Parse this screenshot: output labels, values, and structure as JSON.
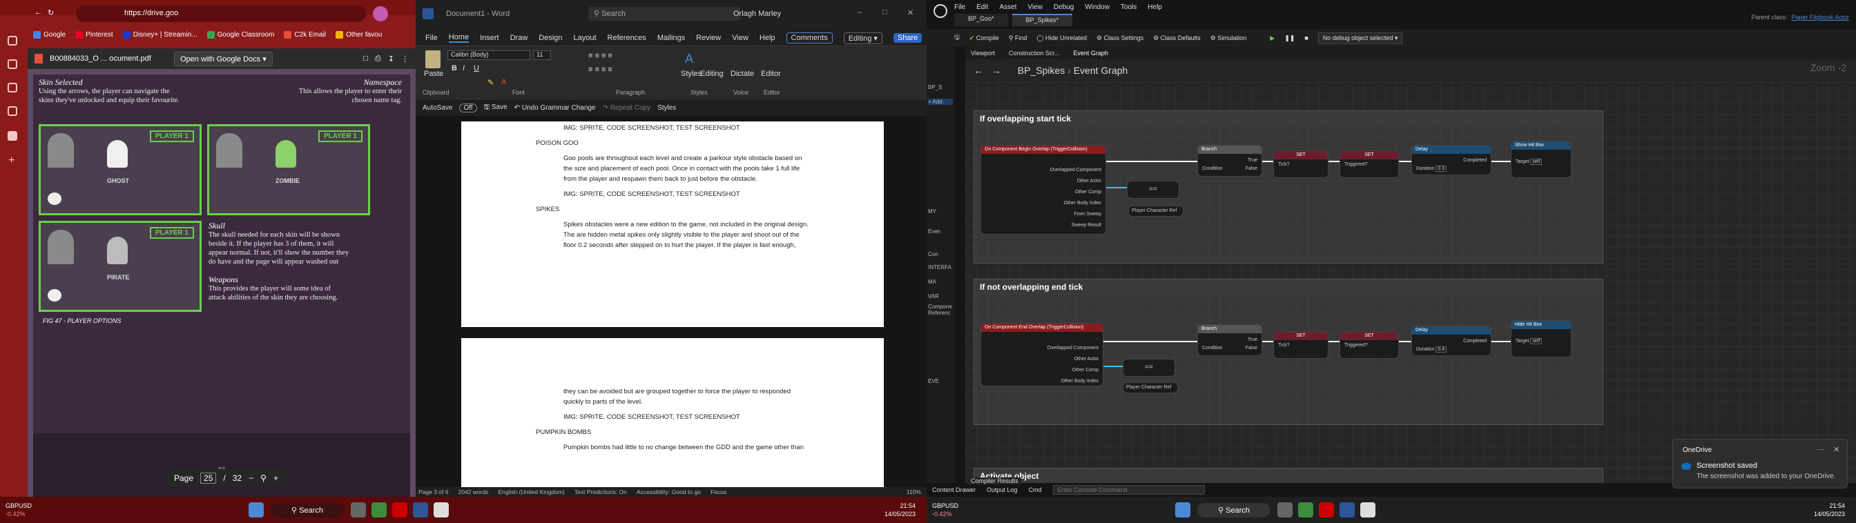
{
  "browser": {
    "url": "https://drive.goo",
    "bookmarks": [
      "Google",
      "Pinterest",
      "Disney+ | Streamin...",
      "Google Classroom",
      "C2k Email",
      "Other favou"
    ],
    "bookmark_colors": [
      "#4285f4",
      "#e60023",
      "#113ccf",
      "#34a853",
      "#e74c3c",
      "#f4b400"
    ],
    "pdf_title": "B00884033_O ... ocument.pdf",
    "open_with": "Open with Google Docs",
    "page": {
      "skin_selected_title": "Skin Selected",
      "skin_selected_text": [
        "Using the arrows, the player can navigate the",
        "skins they've unlocked and equip their favourite."
      ],
      "namespace_title": "Namespace",
      "namespace_text": [
        "This allows the player to enter their",
        "chosen name tag."
      ],
      "skull_title": "Skull",
      "skull_text": [
        "The skull needed for each skin will be shown",
        "beside it. If the player has 3 of them, it will",
        "appear normal. If not, it'll show the number they",
        "do have and the page will appear washed out"
      ],
      "weapons_title": "Weapons",
      "weapons_text": [
        "This provides the player will some idea of",
        "attack abilities of the skin they are choosing."
      ],
      "fig_caption": "FIG 47 - PLAYER OPTIONS",
      "skins": [
        "GHOST",
        "ZOMBIE",
        "PIRATE"
      ],
      "player_label": "PLAYER 1",
      "page_number_mark": "91"
    },
    "page_control": {
      "label": "Page",
      "current": "25",
      "sep": "/",
      "total": "32"
    }
  },
  "word": {
    "title": "Document1 - Word",
    "search": "Search",
    "user": "Orlagh Marley",
    "menu": [
      "File",
      "Home",
      "Insert",
      "Draw",
      "Design",
      "Layout",
      "References",
      "Mailings",
      "Review",
      "View",
      "Help"
    ],
    "comments": "Comments",
    "editing": "Editing",
    "share": "Share",
    "font": "Calibri (Body)",
    "size": "11",
    "groups": [
      "Clipboard",
      "Font",
      "Paragraph",
      "Styles",
      "Voice",
      "Editor"
    ],
    "ribbon_buttons": [
      "Paste",
      "Styles",
      "Editing",
      "Dictate",
      "Editor"
    ],
    "autosave": "AutoSave",
    "autosave_state": "Off",
    "save": "Save",
    "undo": "Undo Grammar Change",
    "repeat": "Repeat Copy",
    "styles_qat": "Styles",
    "page1": [
      {
        "text": "IMG: SPRITE, CODE SCREENSHOT, TEST SCREENSHOT",
        "indent": true
      },
      {
        "text": "POISON GOO",
        "indent": false
      },
      {
        "text": "Goo pools are throughout each level and create a parkour style obstacle based on",
        "indent": true
      },
      {
        "text": "the size and placement of each pool. Once in contact with the pools take 1 full life",
        "indent": true
      },
      {
        "text": "from the player and respawn them back to just before the obstacle.",
        "indent": true
      },
      {
        "text": "IMG: SPRITE, CODE SCREENSHOT, TEST SCREENSHOT",
        "indent": true
      },
      {
        "text": "SPIKES",
        "indent": false
      },
      {
        "text": "Spikes obstacles were a new edition to the game, not included in the original design.",
        "indent": true
      },
      {
        "text": "The are hidden metal spikes only slightly visible to the player and shoot out of the",
        "indent": true
      },
      {
        "text": "floor 0.2 seconds after stepped on to hurt the player. If the player is fast enough,",
        "indent": true
      }
    ],
    "page2": [
      {
        "text": "they can be avoided but are grouped together to force the player to responded",
        "indent": true
      },
      {
        "text": "quickly to parts of the level.",
        "indent": true
      },
      {
        "text": "IMG: SPRITE, CODE SCREENSHOT, TEST SCREENSHOT",
        "indent": true
      },
      {
        "text": "PUMPKIN BOMBS",
        "indent": false
      },
      {
        "text": "Pumpkin bombs had little to no change between the GDD and the game other than",
        "indent": true
      }
    ],
    "status": [
      "Page 3 of 6",
      "2042 words",
      "English (United Kingdom)",
      "Text Predictions: On",
      "Accessibility: Good to go",
      "Focus"
    ],
    "zoom": "110%"
  },
  "ue": {
    "menu": [
      "File",
      "Edit",
      "Asset",
      "View",
      "Debug",
      "Window",
      "Tools",
      "Help"
    ],
    "tabs": [
      "BP_Goo*",
      "BP_Spikes*"
    ],
    "parent_class_label": "Parent class:",
    "parent_class": "Paper Flipbook Actor",
    "toolbar": [
      "Compile",
      "Find",
      "Hide Unrelated",
      "Class Settings",
      "Class Defaults",
      "Simulation"
    ],
    "debug": "No debug object selected",
    "add": "Add",
    "graph_tabs": [
      "Viewport",
      "Construction Scr...",
      "Event Graph"
    ],
    "breadcrumb": [
      "BP_Spikes",
      "Event Graph"
    ],
    "zoom": "Zoom -2",
    "left_items": [
      "BP_S",
      "Add",
      "MY",
      "Even",
      "Con",
      "INTERFA",
      "MA",
      "VAR",
      "Compone",
      "Referenc",
      "EVE"
    ],
    "comment1": "If overlapping start tick",
    "comment2": "If not overlapping end tick",
    "comment3": "Activate object",
    "graph1": {
      "event": "On Component Begin Overlap (TriggerCollision)",
      "pins": [
        "Overlapped Component",
        "Other Actor",
        "Other Comp",
        "Other Body Index",
        "From Sweep",
        "Sweep Result"
      ],
      "equals": "==",
      "player_ref": "Player Character Ref",
      "branch": "Branch",
      "branch_pins": [
        "Condition",
        "True",
        "False"
      ],
      "set1": "SET",
      "set1_var": "Tick?",
      "set2": "SET",
      "set2_var": "Triggered?",
      "delay": "Delay",
      "delay_pins": [
        "Duration",
        "Completed"
      ],
      "delay_val": "0.3",
      "func": "Show Hit Box",
      "func_target_label": "Target",
      "func_target": "self"
    },
    "graph2": {
      "event": "On Component End Overlap (TriggerCollision)",
      "pins": [
        "Overlapped Component",
        "Other Actor",
        "Other Comp",
        "Other Body Index"
      ],
      "equals": "==",
      "player_ref": "Player Character Ref",
      "branch": "Branch",
      "branch_pins": [
        "Condition",
        "True",
        "False"
      ],
      "set1": "SET",
      "set1_var": "Tick?",
      "set2": "SET",
      "set2_var": "Triggered?",
      "delay": "Delay",
      "delay_pins": [
        "Duration",
        "Completed"
      ],
      "delay_val": "0.4",
      "func": "Hide Hit Box",
      "func_target_label": "Target",
      "func_target": "self"
    },
    "bottom": [
      "Content Drawer",
      "Output Log",
      "Cmd",
      "Compiler Results"
    ],
    "console_placeholder": "Enter Console Command",
    "toast_app": "OneDrive",
    "toast_title": "Screenshot saved",
    "toast_body": "The screenshot was added to your OneDrive."
  },
  "taskbar": {
    "ticker": "GBPUSD",
    "change": "-0.42%",
    "search": "Search",
    "time": "21:54",
    "date": "14/05/2023"
  },
  "colors": {
    "event": "#8b1c1c",
    "branch": "#555555",
    "set": "#3a3a5a",
    "delay": "#1d4d73",
    "func": "#1d4d73",
    "accent": "#6bd04a"
  }
}
